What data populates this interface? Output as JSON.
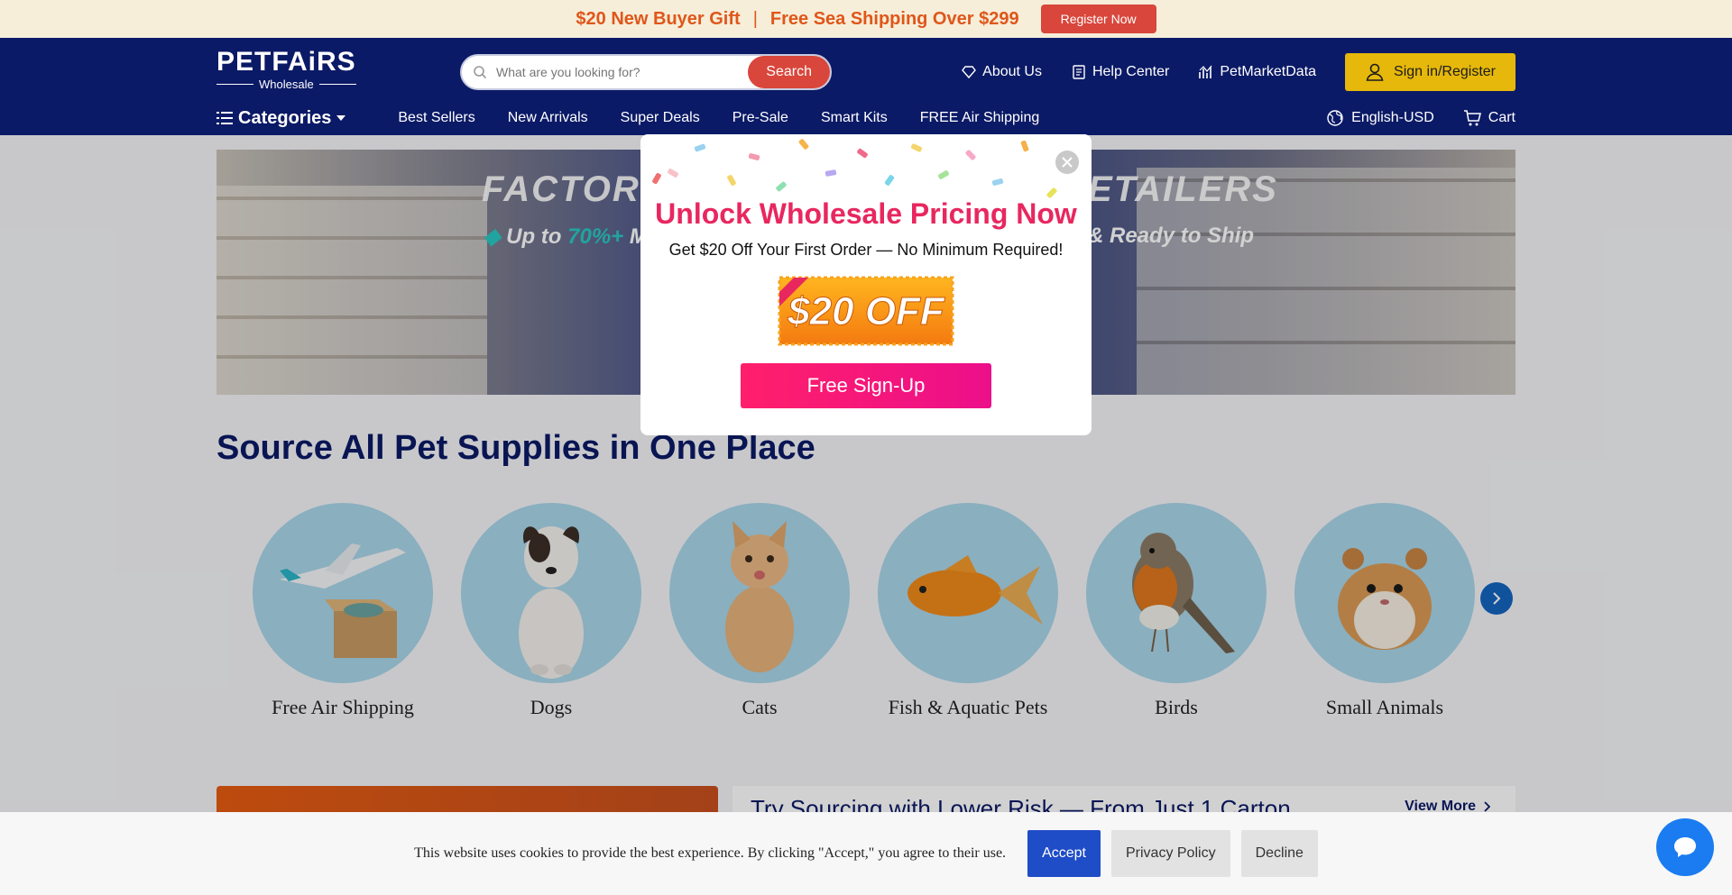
{
  "promo": {
    "gift_text": "$20 New Buyer Gift",
    "separator": "|",
    "shipping_text": "Free Sea Shipping Over $299",
    "register_label": "Register Now",
    "accent_color": "#e0561b"
  },
  "header": {
    "logo_main": "PETFAiRS",
    "logo_sub": "Wholesale",
    "search": {
      "placeholder": "What are you looking for?",
      "button_label": "Search",
      "icon": "search-icon"
    },
    "links": [
      {
        "label": "About Us",
        "icon": "diamond-icon"
      },
      {
        "label": "Help Center",
        "icon": "document-icon"
      },
      {
        "label": "PetMarketData",
        "icon": "bar-chart-icon"
      }
    ],
    "signin_label": "Sign in/Register",
    "signin_icon": "user-icon",
    "bg_color": "#0b1a66"
  },
  "nav": {
    "categories_label": "Categories",
    "items": [
      "Best Sellers",
      "New Arrivals",
      "Super Deals",
      "Pre-Sale",
      "Smart Kits",
      "FREE Air Shipping"
    ],
    "language_label": "English-USD",
    "cart_label": "Cart"
  },
  "banner": {
    "title_left": "FACTORY",
    "title_right": "ETAILERS",
    "sub_prefix": "Up to",
    "sub_highlight": "70%+",
    "sub_suffix": "M",
    "sub_right": "& Ready to Ship"
  },
  "main": {
    "section_title": "Source All Pet Supplies in One Place",
    "categories": [
      {
        "label": "Free Air Shipping",
        "icon": "airplane-box-icon"
      },
      {
        "label": "Dogs",
        "icon": "dog-icon"
      },
      {
        "label": "Cats",
        "icon": "cat-icon"
      },
      {
        "label": "Fish & Aquatic Pets",
        "icon": "fish-icon"
      },
      {
        "label": "Birds",
        "icon": "bird-icon"
      },
      {
        "label": "Small Animals",
        "icon": "hamster-icon"
      }
    ],
    "risk_title": "Try Sourcing with Lower Risk — From Just 1 Carton",
    "view_more_label": "View More"
  },
  "modal": {
    "title": "Unlock Wholesale Pricing Now",
    "subtitle": "Get $20 Off Your First Order — No Minimum Required!",
    "coupon_text": "$20 OFF",
    "signup_label": "Free Sign-Up",
    "title_color": "#e8275f"
  },
  "cookie": {
    "text": "This website uses cookies to provide the best experience. By clicking \"Accept,\" you agree to their use.",
    "accept_label": "Accept",
    "privacy_label": "Privacy Policy",
    "decline_label": "Decline"
  }
}
